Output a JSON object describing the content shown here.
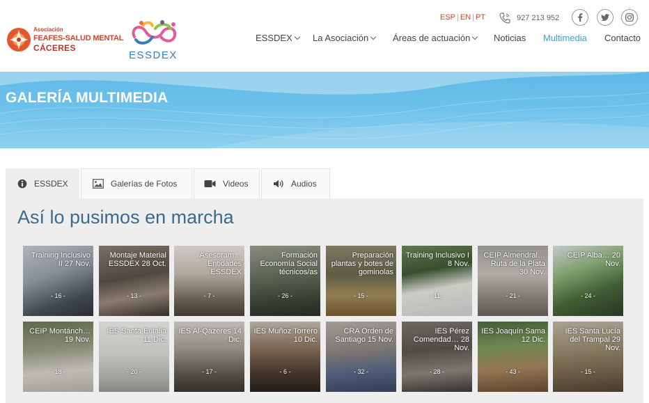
{
  "header": {
    "feafes_logo": {
      "line1": "Asociación",
      "line2": "FEAFES-SALUD MENTAL",
      "line3": "CÁCERES"
    },
    "essdex_logo": {
      "word": "ESSDEX"
    },
    "languages": [
      "ESP",
      "EN",
      "PT"
    ],
    "phone": "927 213 952",
    "social": [
      "facebook-icon",
      "twitter-icon",
      "instagram-icon"
    ],
    "nav": [
      {
        "label": "ESSDEX",
        "dropdown": true
      },
      {
        "label": "La Asociación",
        "dropdown": true
      },
      {
        "label": "Áreas de actuación",
        "dropdown": true
      },
      {
        "label": "Noticias",
        "dropdown": false
      },
      {
        "label": "Multimedia",
        "dropdown": false,
        "active": true
      },
      {
        "label": "Contacto",
        "dropdown": false
      }
    ]
  },
  "banner": {
    "title": "GALERÍA MULTIMEDIA"
  },
  "tabs": [
    {
      "label": "ESSDEX",
      "icon": "info-icon",
      "active": true
    },
    {
      "label": "Galerías de Fotos",
      "icon": "image-icon"
    },
    {
      "label": "Videos",
      "icon": "video-camera-icon"
    },
    {
      "label": "Audios",
      "icon": "speaker-icon"
    }
  ],
  "section": {
    "title": "Así lo pusimos en marcha"
  },
  "gallery": [
    {
      "caption": "Training Inclusivo II 27 Nov.",
      "count": "- 16 -"
    },
    {
      "caption": "Montaje Material ESSDEX 28 Oct.",
      "count": "- 13 -"
    },
    {
      "caption": "Asesoram… Entidades ESSDEX",
      "count": "- 7 -"
    },
    {
      "caption": "Formación Economía Social técnicos/as",
      "count": "- 26 -"
    },
    {
      "caption": "Preparación plantas y botes de gominolas",
      "count": "- 15 -"
    },
    {
      "caption": "Training Inclusivo I 8 Nov.",
      "count": "- 11 -"
    },
    {
      "caption": "CEIP Almendral… Ruta de la Plata 30 Nov.",
      "count": "- 21 -"
    },
    {
      "caption": "CEIP Alba… 20 Nov.",
      "count": "- 24 -"
    },
    {
      "caption": "CEIP Montánch… 19 Nov.",
      "count": "- 18 -"
    },
    {
      "caption": "IES Santa Eulalia 11 Dic.",
      "count": "- 20 -"
    },
    {
      "caption": "IES Al-Qázeres 14 Dic.",
      "count": "- 17 -"
    },
    {
      "caption": "IES Muñoz Torrero 10 Dic.",
      "count": "- 6 -"
    },
    {
      "caption": "CRA Orden de Santiago 15 Nov.",
      "count": "- 32 -"
    },
    {
      "caption": "IES Pérez Comendad… 28 Nov.",
      "count": "- 28 -"
    },
    {
      "caption": "IES Joaquín Sama 12 Dic.",
      "count": "- 43 -"
    },
    {
      "caption": "IES Santa Lucía del Trampal 29 Nov.",
      "count": "- 15 -"
    }
  ],
  "colors": {
    "brand_red": "#d6402a",
    "accent_blue": "#3aa3cf",
    "title_blue": "#3a6a8c",
    "banner_blue": "#6dc1ea"
  }
}
